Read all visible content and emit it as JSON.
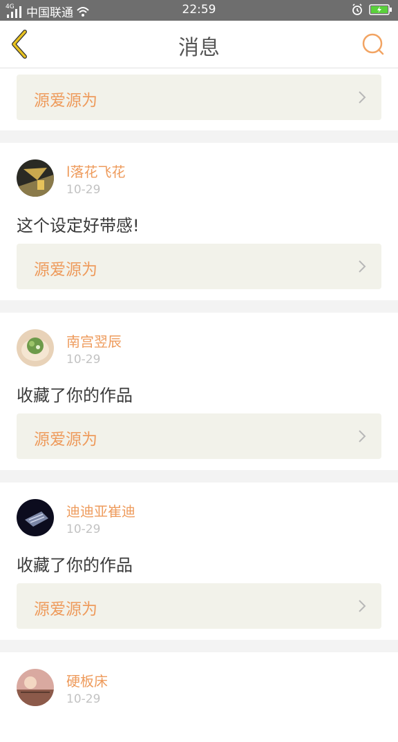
{
  "status_bar": {
    "network_badge": "4G",
    "carrier": "中国联通",
    "time": "22:59"
  },
  "nav": {
    "title": "消息"
  },
  "colors": {
    "accent": "#ee9b5c",
    "back_icon": "#e8c220",
    "battery": "#5ad13c"
  },
  "top_item": {
    "title": "源爱源为"
  },
  "messages": [
    {
      "user": "l落花飞花",
      "date": "10-29",
      "text": "这个设定好带感!",
      "item_title": "源爱源为"
    },
    {
      "user": "南宫翌辰",
      "date": "10-29",
      "text": "收藏了你的作品",
      "item_title": "源爱源为"
    },
    {
      "user": "迪迪亚崔迪",
      "date": "10-29",
      "text": "收藏了你的作品",
      "item_title": "源爱源为"
    },
    {
      "user": "硬板床",
      "date": "10-29"
    }
  ]
}
